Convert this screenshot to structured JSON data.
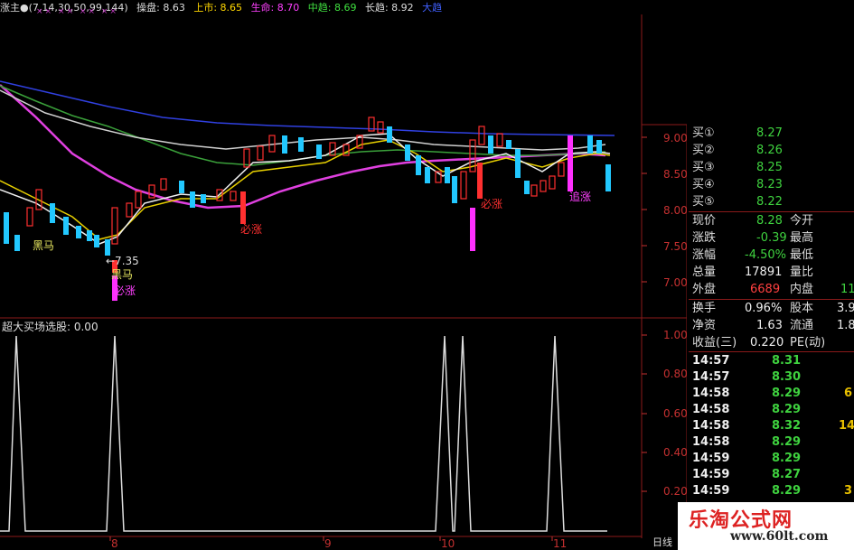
{
  "top_bar": {
    "items": [
      {
        "text": "涨主●(7,14,30,50,99,144)",
        "color": "#dddddd"
      },
      {
        "text": "操盘: 8.63",
        "color": "#dddddd"
      },
      {
        "text": "上市: 8.65",
        "color": "#ffd700"
      },
      {
        "text": "生命: 8.70",
        "color": "#ff40ff"
      },
      {
        "text": "中趋: 8.69",
        "color": "#40e040"
      },
      {
        "text": "长趋: 8.92",
        "color": "#dddddd"
      },
      {
        "text": "大趋",
        "color": "#4060ff"
      }
    ],
    "marks": "×× ×× ×× ××"
  },
  "price_chart": {
    "y_ticks": [
      "9.00",
      "8.50",
      "8.00",
      "7.50",
      "7.00"
    ],
    "annotations": {
      "heima_1": "黑马",
      "heima_2": "黑马",
      "low_price": "←7.35",
      "bizhang_1": "必涨",
      "bizhang_2": "必涨",
      "bizhang_3": "必涨",
      "zhuizhang": "追涨"
    }
  },
  "indicator": {
    "title": "超大买场选股: 0.00",
    "y_ticks": [
      "1.00",
      "0.80",
      "0.60",
      "0.40",
      "0.20"
    ]
  },
  "x_axis": {
    "labels": [
      "8",
      "9",
      "10",
      "11"
    ],
    "period": "日线"
  },
  "quote_panel": {
    "bids": [
      {
        "label": "买①",
        "price": "8.27"
      },
      {
        "label": "买②",
        "price": "8.26"
      },
      {
        "label": "买③",
        "price": "8.25"
      },
      {
        "label": "买④",
        "price": "8.23"
      },
      {
        "label": "买⑤",
        "price": "8.22"
      }
    ],
    "stats": [
      {
        "l1": "现价",
        "v1": "8.28",
        "l2": "今开",
        "v2": ""
      },
      {
        "l1": "涨跌",
        "v1": "-0.39",
        "l2": "最高",
        "v2": ""
      },
      {
        "l1": "涨幅",
        "v1": "-4.50%",
        "l2": "最低",
        "v2": ""
      },
      {
        "l1": "总量",
        "v1": "17891",
        "l2": "量比",
        "v2": ""
      },
      {
        "l1": "外盘",
        "v1": "6689",
        "l2": "内盘",
        "v2": "11"
      }
    ],
    "stats2": [
      {
        "l1": "换手",
        "v1": "0.96%",
        "l2": "股本",
        "v2": "3.9"
      },
      {
        "l1": "净资",
        "v1": "1.63",
        "l2": "流通",
        "v2": "1.8"
      },
      {
        "l1": "收益(三)",
        "v1": "0.220",
        "l2": "PE(动)",
        "v2": ""
      }
    ],
    "ticks": [
      {
        "time": "14:57",
        "price": "8.31",
        "vol": ""
      },
      {
        "time": "14:57",
        "price": "8.30",
        "vol": ""
      },
      {
        "time": "14:58",
        "price": "8.29",
        "vol": "6"
      },
      {
        "time": "14:58",
        "price": "8.29",
        "vol": ""
      },
      {
        "time": "14:58",
        "price": "8.32",
        "vol": "14"
      },
      {
        "time": "14:58",
        "price": "8.29",
        "vol": ""
      },
      {
        "time": "14:59",
        "price": "8.29",
        "vol": ""
      },
      {
        "time": "14:59",
        "price": "8.27",
        "vol": ""
      },
      {
        "time": "14:59",
        "price": "8.29",
        "vol": "3"
      }
    ]
  },
  "watermark": {
    "title": "乐淘公式网",
    "url": "www.60lt.com"
  },
  "colors": {
    "grid": "#8b1a1a",
    "up": "#ff3030",
    "down": "#22c8ff",
    "price_green": "#3fd23f",
    "price_red": "#ff4040"
  }
}
